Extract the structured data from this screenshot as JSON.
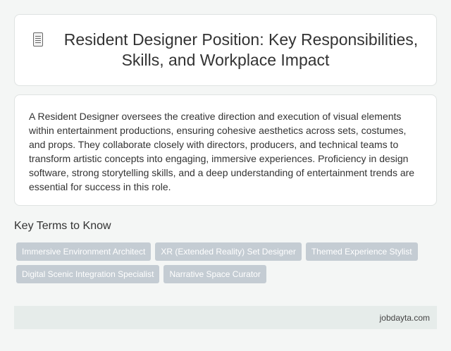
{
  "header": {
    "icon": "document-icon",
    "title": "Resident Designer Position: Key Responsibilities, Skills, and Workplace Impact"
  },
  "description": "A Resident Designer oversees the creative direction and execution of visual elements within entertainment productions, ensuring cohesive aesthetics across sets, costumes, and props. They collaborate closely with directors, producers, and technical teams to transform artistic concepts into engaging, immersive experiences. Proficiency in design software, strong storytelling skills, and a deep understanding of entertainment trends are essential for success in this role.",
  "key_terms": {
    "heading": "Key Terms to Know",
    "tags": [
      "Immersive Environment Architect",
      "XR (Extended Reality) Set Designer",
      "Themed Experience Stylist",
      "Digital Scenic Integration Specialist",
      "Narrative Space Curator"
    ]
  },
  "footer": {
    "site": "jobdayta.com"
  }
}
